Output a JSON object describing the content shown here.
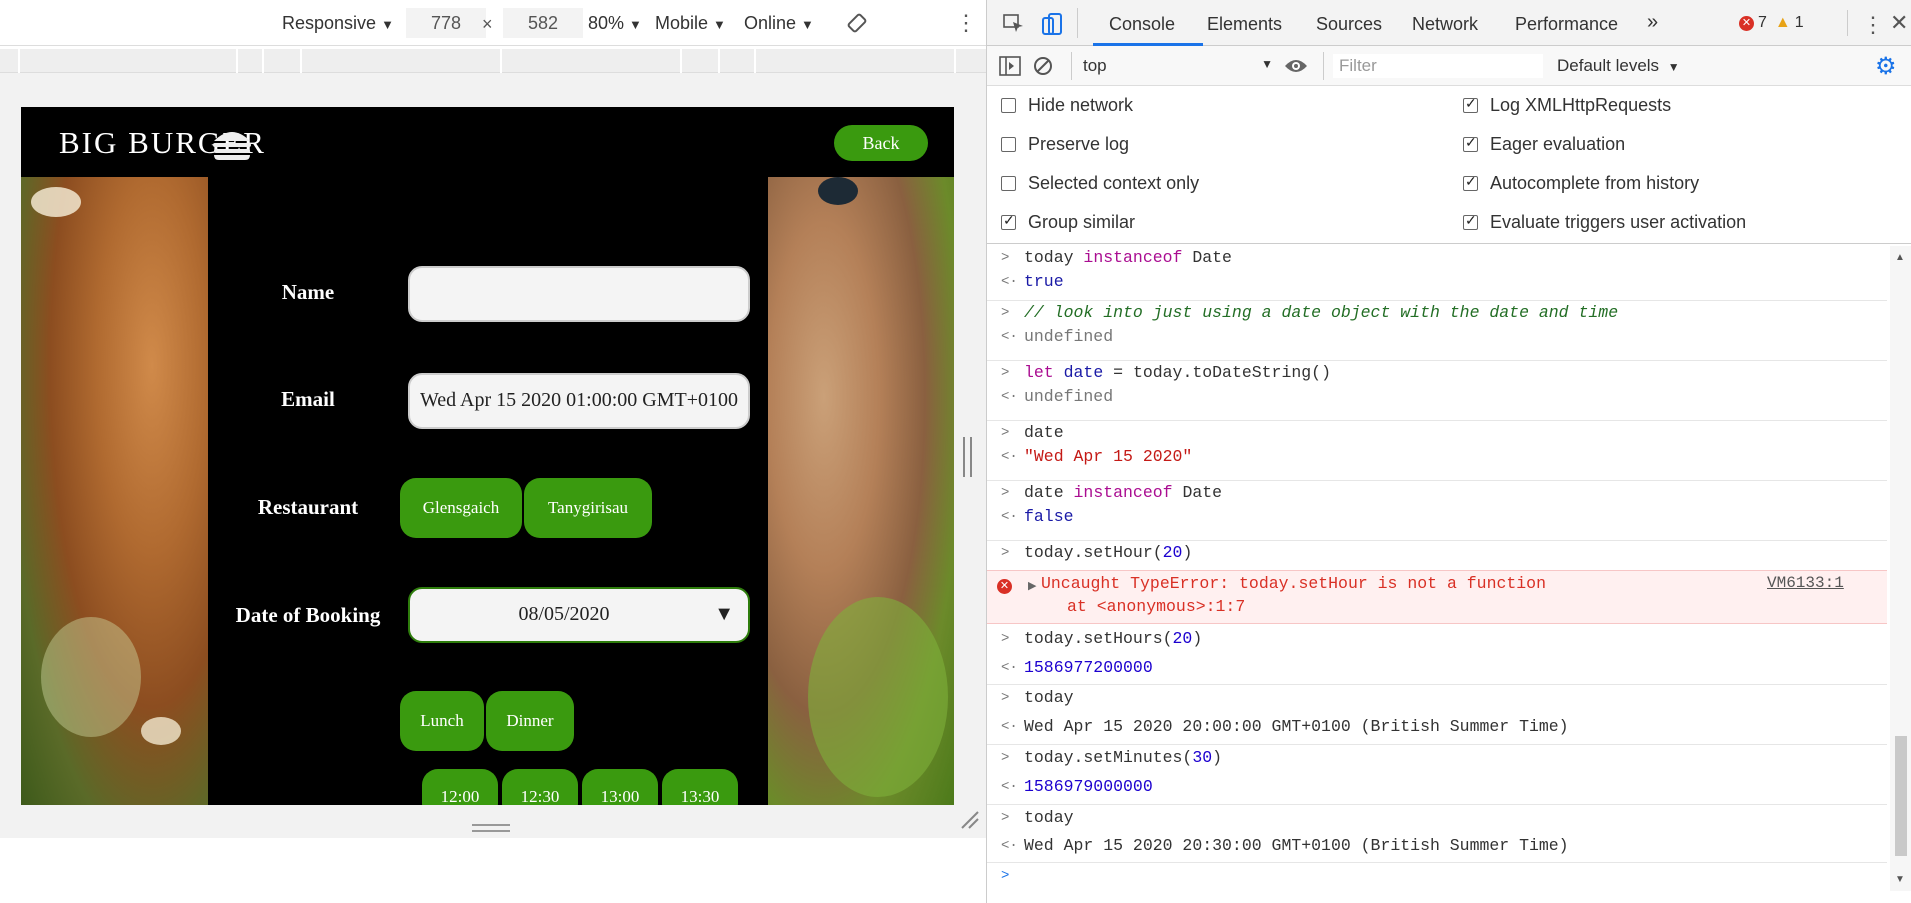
{
  "device_toolbar": {
    "device": "Responsive",
    "width": "778",
    "times": "×",
    "height": "582",
    "zoom": "80%",
    "mode": "Mobile",
    "network": "Online"
  },
  "site": {
    "logo_text": "BIG BURGER",
    "back_label": "Back",
    "form": {
      "name_label": "Name",
      "name_value": "",
      "email_label": "Email",
      "email_value": "Wed Apr 15 2020 01:00:00 GMT+0100",
      "restaurant_label": "Restaurant",
      "restaurants": [
        "Glensgaich",
        "Tanygirisau"
      ],
      "date_label": "Date of Booking",
      "date_value": "08/05/2020",
      "meals": [
        "Lunch",
        "Dinner"
      ],
      "times": [
        "12:00",
        "12:30",
        "13:00",
        "13:30"
      ]
    }
  },
  "devtools": {
    "tabs": [
      "Console",
      "Elements",
      "Sources",
      "Network",
      "Performance"
    ],
    "more": "»",
    "error_count": "7",
    "warning_count": "1",
    "context": "top",
    "filter_placeholder": "Filter",
    "levels": "Default levels",
    "settings": {
      "left": [
        "Hide network",
        "Preserve log",
        "Selected context only",
        "Group similar"
      ],
      "left_checked": [
        false,
        false,
        false,
        true
      ],
      "right": [
        "Log XMLHttpRequests",
        "Eager evaluation",
        "Autocomplete from history",
        "Evaluate triggers user activation"
      ],
      "right_checked": [
        true,
        true,
        true,
        true
      ]
    },
    "console": {
      "l1_in_a": "today ",
      "l1_in_kw": "instanceof",
      "l1_in_b": " Date",
      "l1_out": "true",
      "l2_in": "// look into just using a date object with the date and time",
      "l2_out": "undefined",
      "l3_in_kw": "let",
      "l3_in_var": "date",
      "l3_in_b": " = today.toDateString()",
      "l3_out": "undefined",
      "l4_in": "date",
      "l4_out": "\"Wed Apr 15 2020\"",
      "l5_in_a": "date ",
      "l5_in_kw": "instanceof",
      "l5_in_b": " Date",
      "l5_out": "false",
      "l6_in_a": "today.setHour(",
      "l6_in_num": "20",
      "l6_in_b": ")",
      "err_line1": "Uncaught TypeError: today.setHour is not a function",
      "err_line2": "at <anonymous>:1:7",
      "err_src": "VM6133:1",
      "l7_in_a": "today.setHours(",
      "l7_in_num": "20",
      "l7_in_b": ")",
      "l7_out": "1586977200000",
      "l8_in": "today",
      "l8_out": "Wed Apr 15 2020 20:00:00 GMT+0100 (British Summer Time)",
      "l9_in_a": "today.setMinutes(",
      "l9_in_num": "30",
      "l9_in_b": ")",
      "l9_out": "1586979000000",
      "l10_in": "today",
      "l10_out": "Wed Apr 15 2020 20:30:00 GMT+0100 (British Summer Time)"
    }
  }
}
